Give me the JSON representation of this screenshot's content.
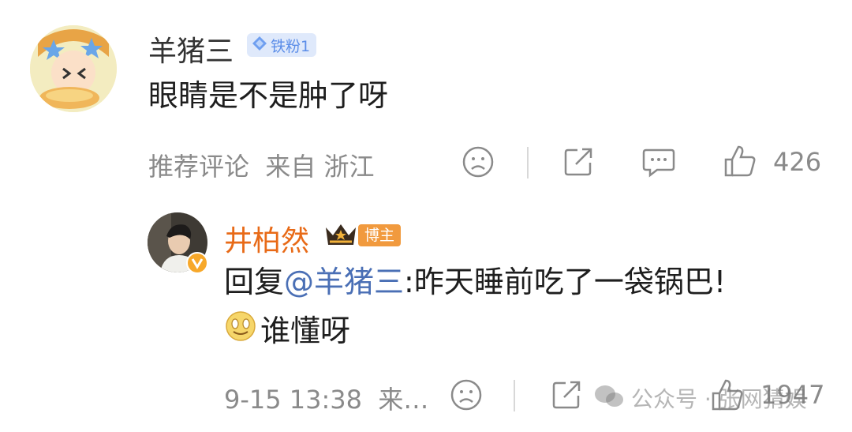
{
  "comment": {
    "username": "羊猪三",
    "fan_badge": "铁粉1",
    "text": "眼睛是不是肿了呀",
    "meta": "推荐评论  来自 浙江",
    "like_count": "426"
  },
  "reply": {
    "username": "井柏然",
    "badge": "博主",
    "prefix": "回复",
    "mention": "@羊猪三",
    "text_line1": ":昨天睡前吃了一袋锅巴!",
    "text_line2": "谁懂呀",
    "meta": "9-15 13:38  来…",
    "like_count": "1947"
  },
  "watermark": {
    "text": "公众号 · 张网猜娱"
  },
  "colors": {
    "accent_orange": "#e86a17",
    "mention_blue": "#4a6fb5",
    "meta_gray": "#8a8a8a"
  }
}
